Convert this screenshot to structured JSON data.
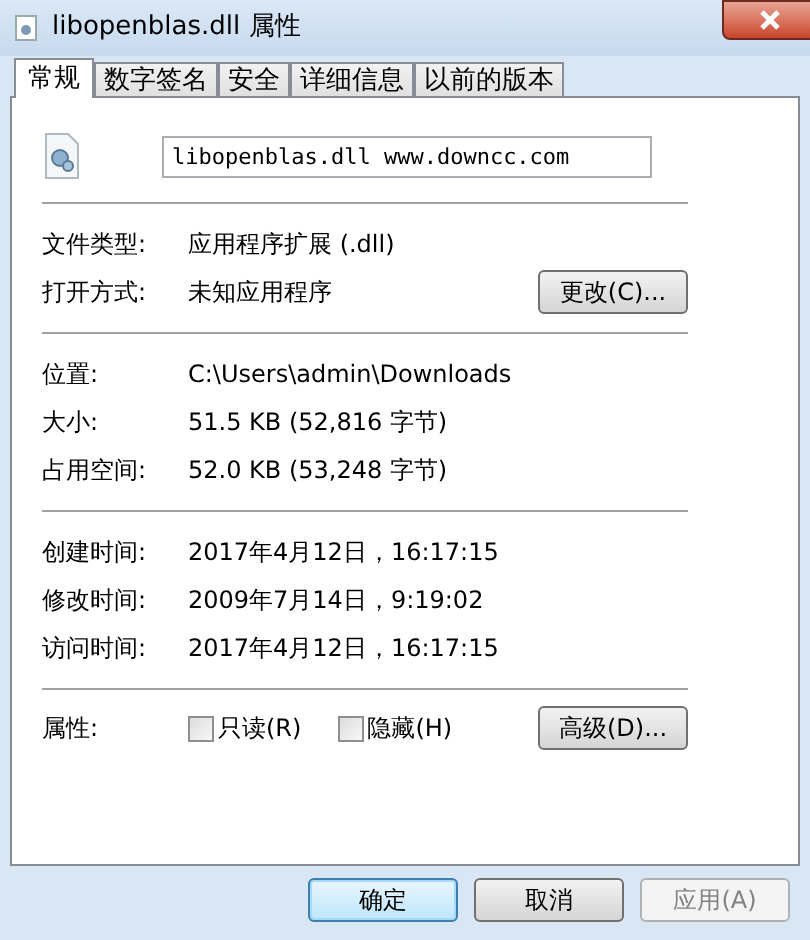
{
  "window": {
    "title": "libopenblas.dll 属性"
  },
  "tabs": [
    {
      "label": "常规",
      "selected": true
    },
    {
      "label": "数字签名",
      "selected": false
    },
    {
      "label": "安全",
      "selected": false
    },
    {
      "label": "详细信息",
      "selected": false
    },
    {
      "label": "以前的版本",
      "selected": false
    }
  ],
  "name_field": {
    "value": "libopenblas.dll www.downcc.com"
  },
  "groups": [
    [
      {
        "label": "文件类型:",
        "value": "应用程序扩展 (.dll)"
      },
      {
        "label": "打开方式:",
        "value": "未知应用程序",
        "button": "更改(C)..."
      }
    ],
    [
      {
        "label": "位置:",
        "value": "C:\\Users\\admin\\Downloads"
      },
      {
        "label": "大小:",
        "value": "51.5 KB (52,816 字节)"
      },
      {
        "label": "占用空间:",
        "value": "52.0 KB (53,248 字节)"
      }
    ],
    [
      {
        "label": "创建时间:",
        "value": "2017年4月12日，16:17:15"
      },
      {
        "label": "修改时间:",
        "value": "2009年7月14日，9:19:02"
      },
      {
        "label": "访问时间:",
        "value": "2017年4月12日，16:17:15"
      }
    ]
  ],
  "attributes": {
    "label": "属性:",
    "checkboxes": [
      {
        "label": "只读(R)",
        "checked": false
      },
      {
        "label": "隐藏(H)",
        "checked": false
      }
    ],
    "button": "高级(D)..."
  },
  "buttons": [
    {
      "label": "确定",
      "kind": "default",
      "disabled": false
    },
    {
      "label": "取消",
      "kind": "normal",
      "disabled": false
    },
    {
      "label": "应用(A)",
      "kind": "normal",
      "disabled": true
    }
  ]
}
